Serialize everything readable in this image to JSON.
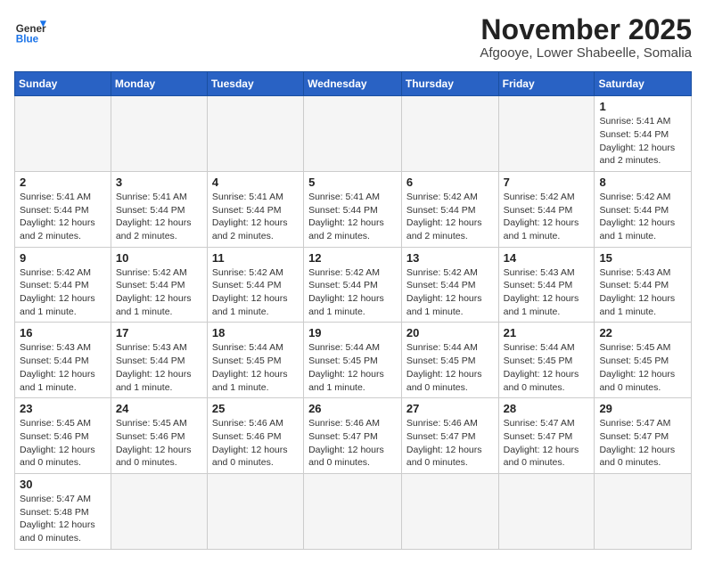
{
  "header": {
    "logo_general": "General",
    "logo_blue": "Blue",
    "month_title": "November 2025",
    "location": "Afgooye, Lower Shabeelle, Somalia"
  },
  "weekdays": [
    "Sunday",
    "Monday",
    "Tuesday",
    "Wednesday",
    "Thursday",
    "Friday",
    "Saturday"
  ],
  "weeks": [
    [
      {
        "day": "",
        "info": ""
      },
      {
        "day": "",
        "info": ""
      },
      {
        "day": "",
        "info": ""
      },
      {
        "day": "",
        "info": ""
      },
      {
        "day": "",
        "info": ""
      },
      {
        "day": "",
        "info": ""
      },
      {
        "day": "1",
        "info": "Sunrise: 5:41 AM\nSunset: 5:44 PM\nDaylight: 12 hours\nand 2 minutes."
      }
    ],
    [
      {
        "day": "2",
        "info": "Sunrise: 5:41 AM\nSunset: 5:44 PM\nDaylight: 12 hours\nand 2 minutes."
      },
      {
        "day": "3",
        "info": "Sunrise: 5:41 AM\nSunset: 5:44 PM\nDaylight: 12 hours\nand 2 minutes."
      },
      {
        "day": "4",
        "info": "Sunrise: 5:41 AM\nSunset: 5:44 PM\nDaylight: 12 hours\nand 2 minutes."
      },
      {
        "day": "5",
        "info": "Sunrise: 5:41 AM\nSunset: 5:44 PM\nDaylight: 12 hours\nand 2 minutes."
      },
      {
        "day": "6",
        "info": "Sunrise: 5:42 AM\nSunset: 5:44 PM\nDaylight: 12 hours\nand 2 minutes."
      },
      {
        "day": "7",
        "info": "Sunrise: 5:42 AM\nSunset: 5:44 PM\nDaylight: 12 hours\nand 1 minute."
      },
      {
        "day": "8",
        "info": "Sunrise: 5:42 AM\nSunset: 5:44 PM\nDaylight: 12 hours\nand 1 minute."
      }
    ],
    [
      {
        "day": "9",
        "info": "Sunrise: 5:42 AM\nSunset: 5:44 PM\nDaylight: 12 hours\nand 1 minute."
      },
      {
        "day": "10",
        "info": "Sunrise: 5:42 AM\nSunset: 5:44 PM\nDaylight: 12 hours\nand 1 minute."
      },
      {
        "day": "11",
        "info": "Sunrise: 5:42 AM\nSunset: 5:44 PM\nDaylight: 12 hours\nand 1 minute."
      },
      {
        "day": "12",
        "info": "Sunrise: 5:42 AM\nSunset: 5:44 PM\nDaylight: 12 hours\nand 1 minute."
      },
      {
        "day": "13",
        "info": "Sunrise: 5:42 AM\nSunset: 5:44 PM\nDaylight: 12 hours\nand 1 minute."
      },
      {
        "day": "14",
        "info": "Sunrise: 5:43 AM\nSunset: 5:44 PM\nDaylight: 12 hours\nand 1 minute."
      },
      {
        "day": "15",
        "info": "Sunrise: 5:43 AM\nSunset: 5:44 PM\nDaylight: 12 hours\nand 1 minute."
      }
    ],
    [
      {
        "day": "16",
        "info": "Sunrise: 5:43 AM\nSunset: 5:44 PM\nDaylight: 12 hours\nand 1 minute."
      },
      {
        "day": "17",
        "info": "Sunrise: 5:43 AM\nSunset: 5:44 PM\nDaylight: 12 hours\nand 1 minute."
      },
      {
        "day": "18",
        "info": "Sunrise: 5:44 AM\nSunset: 5:45 PM\nDaylight: 12 hours\nand 1 minute."
      },
      {
        "day": "19",
        "info": "Sunrise: 5:44 AM\nSunset: 5:45 PM\nDaylight: 12 hours\nand 1 minute."
      },
      {
        "day": "20",
        "info": "Sunrise: 5:44 AM\nSunset: 5:45 PM\nDaylight: 12 hours\nand 0 minutes."
      },
      {
        "day": "21",
        "info": "Sunrise: 5:44 AM\nSunset: 5:45 PM\nDaylight: 12 hours\nand 0 minutes."
      },
      {
        "day": "22",
        "info": "Sunrise: 5:45 AM\nSunset: 5:45 PM\nDaylight: 12 hours\nand 0 minutes."
      }
    ],
    [
      {
        "day": "23",
        "info": "Sunrise: 5:45 AM\nSunset: 5:46 PM\nDaylight: 12 hours\nand 0 minutes."
      },
      {
        "day": "24",
        "info": "Sunrise: 5:45 AM\nSunset: 5:46 PM\nDaylight: 12 hours\nand 0 minutes."
      },
      {
        "day": "25",
        "info": "Sunrise: 5:46 AM\nSunset: 5:46 PM\nDaylight: 12 hours\nand 0 minutes."
      },
      {
        "day": "26",
        "info": "Sunrise: 5:46 AM\nSunset: 5:47 PM\nDaylight: 12 hours\nand 0 minutes."
      },
      {
        "day": "27",
        "info": "Sunrise: 5:46 AM\nSunset: 5:47 PM\nDaylight: 12 hours\nand 0 minutes."
      },
      {
        "day": "28",
        "info": "Sunrise: 5:47 AM\nSunset: 5:47 PM\nDaylight: 12 hours\nand 0 minutes."
      },
      {
        "day": "29",
        "info": "Sunrise: 5:47 AM\nSunset: 5:47 PM\nDaylight: 12 hours\nand 0 minutes."
      }
    ],
    [
      {
        "day": "30",
        "info": "Sunrise: 5:47 AM\nSunset: 5:48 PM\nDaylight: 12 hours\nand 0 minutes."
      },
      {
        "day": "",
        "info": ""
      },
      {
        "day": "",
        "info": ""
      },
      {
        "day": "",
        "info": ""
      },
      {
        "day": "",
        "info": ""
      },
      {
        "day": "",
        "info": ""
      },
      {
        "day": "",
        "info": ""
      }
    ]
  ]
}
